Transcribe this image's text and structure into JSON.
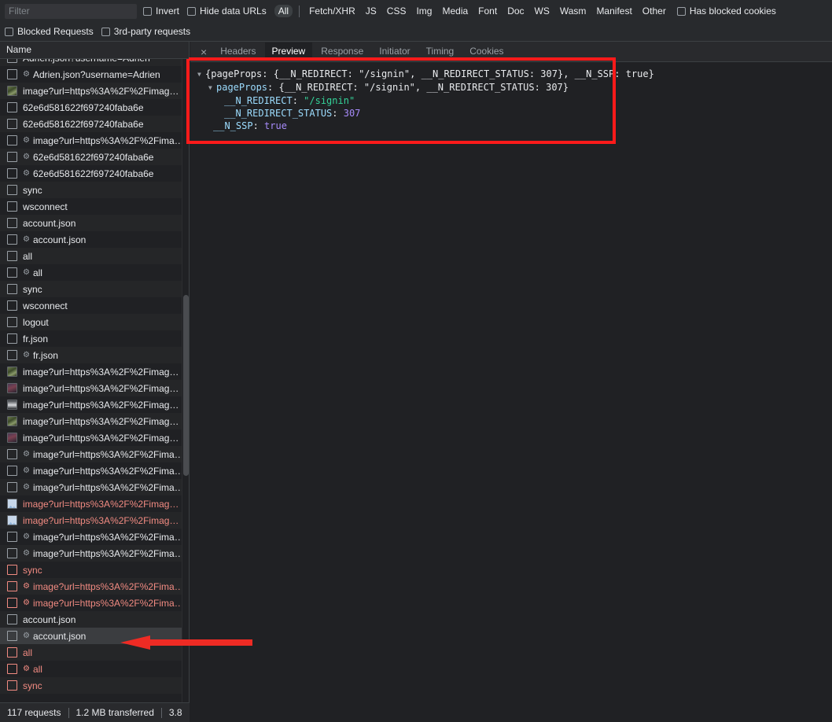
{
  "toolbar": {
    "filter_placeholder": "Filter",
    "filter_value": "",
    "checkboxes_row1": [
      {
        "label": "Invert",
        "checked": false
      },
      {
        "label": "Hide data URLs",
        "checked": false
      }
    ],
    "type_filters": [
      {
        "label": "All",
        "selected": true
      },
      {
        "label": "Fetch/XHR",
        "selected": false
      },
      {
        "label": "JS",
        "selected": false
      },
      {
        "label": "CSS",
        "selected": false
      },
      {
        "label": "Img",
        "selected": false
      },
      {
        "label": "Media",
        "selected": false
      },
      {
        "label": "Font",
        "selected": false
      },
      {
        "label": "Doc",
        "selected": false
      },
      {
        "label": "WS",
        "selected": false
      },
      {
        "label": "Wasm",
        "selected": false
      },
      {
        "label": "Manifest",
        "selected": false
      },
      {
        "label": "Other",
        "selected": false
      }
    ],
    "has_blocked_cookies": {
      "label": "Has blocked cookies",
      "checked": false
    },
    "checkboxes_row2": [
      {
        "label": "Blocked Requests",
        "checked": false
      },
      {
        "label": "3rd-party requests",
        "checked": false
      }
    ]
  },
  "request_list": {
    "column_header": "Name",
    "rows": [
      {
        "name": "Adrien.json?username=Adrien",
        "icon": "doc-icon",
        "gear": false,
        "error": false,
        "selected": false,
        "clipped": true
      },
      {
        "name": "Adrien.json?username=Adrien",
        "icon": "doc-icon",
        "gear": true,
        "error": false,
        "selected": false
      },
      {
        "name": "image?url=https%3A%2F%2Fimag…",
        "icon": "image-thumbnail-a",
        "gear": false,
        "error": false,
        "selected": false
      },
      {
        "name": "62e6d581622f697240faba6e",
        "icon": "doc-icon",
        "gear": false,
        "error": false,
        "selected": false
      },
      {
        "name": "62e6d581622f697240faba6e",
        "icon": "doc-icon",
        "gear": false,
        "error": false,
        "selected": false
      },
      {
        "name": "image?url=https%3A%2F%2Fima…",
        "icon": "doc-icon",
        "gear": true,
        "error": false,
        "selected": false
      },
      {
        "name": "62e6d581622f697240faba6e",
        "icon": "doc-icon",
        "gear": true,
        "error": false,
        "selected": false
      },
      {
        "name": "62e6d581622f697240faba6e",
        "icon": "doc-icon",
        "gear": true,
        "error": false,
        "selected": false
      },
      {
        "name": "sync",
        "icon": "doc-icon",
        "gear": false,
        "error": false,
        "selected": false
      },
      {
        "name": "wsconnect",
        "icon": "doc-icon",
        "gear": false,
        "error": false,
        "selected": false
      },
      {
        "name": "account.json",
        "icon": "doc-icon",
        "gear": false,
        "error": false,
        "selected": false
      },
      {
        "name": "account.json",
        "icon": "doc-icon",
        "gear": true,
        "error": false,
        "selected": false
      },
      {
        "name": "all",
        "icon": "doc-icon",
        "gear": false,
        "error": false,
        "selected": false
      },
      {
        "name": "all",
        "icon": "doc-icon",
        "gear": true,
        "error": false,
        "selected": false
      },
      {
        "name": "sync",
        "icon": "doc-icon",
        "gear": false,
        "error": false,
        "selected": false
      },
      {
        "name": "wsconnect",
        "icon": "doc-icon",
        "gear": false,
        "error": false,
        "selected": false
      },
      {
        "name": "logout",
        "icon": "doc-icon",
        "gear": false,
        "error": false,
        "selected": false
      },
      {
        "name": "fr.json",
        "icon": "doc-icon",
        "gear": false,
        "error": false,
        "selected": false
      },
      {
        "name": "fr.json",
        "icon": "doc-icon",
        "gear": true,
        "error": false,
        "selected": false
      },
      {
        "name": "image?url=https%3A%2F%2Fimag…",
        "icon": "image-thumbnail-a",
        "gear": false,
        "error": false,
        "selected": false
      },
      {
        "name": "image?url=https%3A%2F%2Fimag…",
        "icon": "image-thumbnail-b",
        "gear": false,
        "error": false,
        "selected": false
      },
      {
        "name": "image?url=https%3A%2F%2Fimag…",
        "icon": "image-thumbnail-c",
        "gear": false,
        "error": false,
        "selected": false
      },
      {
        "name": "image?url=https%3A%2F%2Fimag…",
        "icon": "image-thumbnail-a",
        "gear": false,
        "error": false,
        "selected": false
      },
      {
        "name": "image?url=https%3A%2F%2Fimag…",
        "icon": "image-thumbnail-b",
        "gear": false,
        "error": false,
        "selected": false
      },
      {
        "name": "image?url=https%3A%2F%2Fima…",
        "icon": "doc-icon",
        "gear": true,
        "error": false,
        "selected": false
      },
      {
        "name": "image?url=https%3A%2F%2Fima…",
        "icon": "doc-icon",
        "gear": true,
        "error": false,
        "selected": false
      },
      {
        "name": "image?url=https%3A%2F%2Fima…",
        "icon": "doc-icon",
        "gear": true,
        "error": false,
        "selected": false
      },
      {
        "name": "image?url=https%3A%2F%2Fimag…",
        "icon": "broken-image-icon",
        "gear": false,
        "error": true,
        "selected": false
      },
      {
        "name": "image?url=https%3A%2F%2Fimag…",
        "icon": "broken-image-icon",
        "gear": false,
        "error": true,
        "selected": false
      },
      {
        "name": "image?url=https%3A%2F%2Fima…",
        "icon": "doc-icon",
        "gear": true,
        "error": false,
        "selected": false
      },
      {
        "name": "image?url=https%3A%2F%2Fima…",
        "icon": "doc-icon",
        "gear": true,
        "error": false,
        "selected": false
      },
      {
        "name": "sync",
        "icon": "doc-icon",
        "gear": false,
        "error": true,
        "selected": false
      },
      {
        "name": "image?url=https%3A%2F%2Fima…",
        "icon": "doc-icon",
        "gear": true,
        "error": true,
        "selected": false
      },
      {
        "name": "image?url=https%3A%2F%2Fima…",
        "icon": "doc-icon",
        "gear": true,
        "error": true,
        "selected": false
      },
      {
        "name": "account.json",
        "icon": "doc-icon",
        "gear": false,
        "error": false,
        "selected": false
      },
      {
        "name": "account.json",
        "icon": "doc-icon",
        "gear": true,
        "error": false,
        "selected": true
      },
      {
        "name": "all",
        "icon": "doc-icon",
        "gear": false,
        "error": true,
        "selected": false
      },
      {
        "name": "all",
        "icon": "doc-icon",
        "gear": true,
        "error": true,
        "selected": false
      },
      {
        "name": "sync",
        "icon": "doc-icon",
        "gear": false,
        "error": true,
        "selected": false
      }
    ]
  },
  "status_bar": {
    "requests": "117 requests",
    "transferred": "1.2 MB transferred",
    "resources": "3.8"
  },
  "detail_tabs": {
    "close_label": "×",
    "tabs": [
      {
        "label": "Headers",
        "active": false
      },
      {
        "label": "Preview",
        "active": true
      },
      {
        "label": "Response",
        "active": false
      },
      {
        "label": "Initiator",
        "active": false
      },
      {
        "label": "Timing",
        "active": false
      },
      {
        "label": "Cookies",
        "active": false
      }
    ]
  },
  "preview": {
    "line1": {
      "triangle": "▼",
      "text_open": "{pageProps: {",
      "key1": "__N_REDIRECT",
      "colon": ": ",
      "val1": "\"/signin\"",
      "comma1": ", ",
      "key2": "__N_REDIRECT_STATUS",
      "val2": "307",
      "close1": "}, ",
      "key3": "__N_SSP",
      "val3": "true",
      "close2": "}"
    },
    "line2": {
      "triangle": "▼",
      "key": "pageProps",
      "colon": ": ",
      "open": "{",
      "key1": "__N_REDIRECT",
      "val1": "\"/signin\"",
      "comma": ", ",
      "key2": "__N_REDIRECT_STATUS",
      "val2": "307",
      "close": "}"
    },
    "line3": {
      "key": "__N_REDIRECT",
      "colon": ": ",
      "value": "\"/signin\""
    },
    "line4": {
      "key": "__N_REDIRECT_STATUS",
      "colon": ": ",
      "value": "307"
    },
    "line5": {
      "key": "__N_SSP",
      "colon": ": ",
      "value": "true"
    }
  },
  "annotations": {
    "highlight_box_color": "#ff1a1a",
    "arrow_color": "#ee2b24"
  }
}
